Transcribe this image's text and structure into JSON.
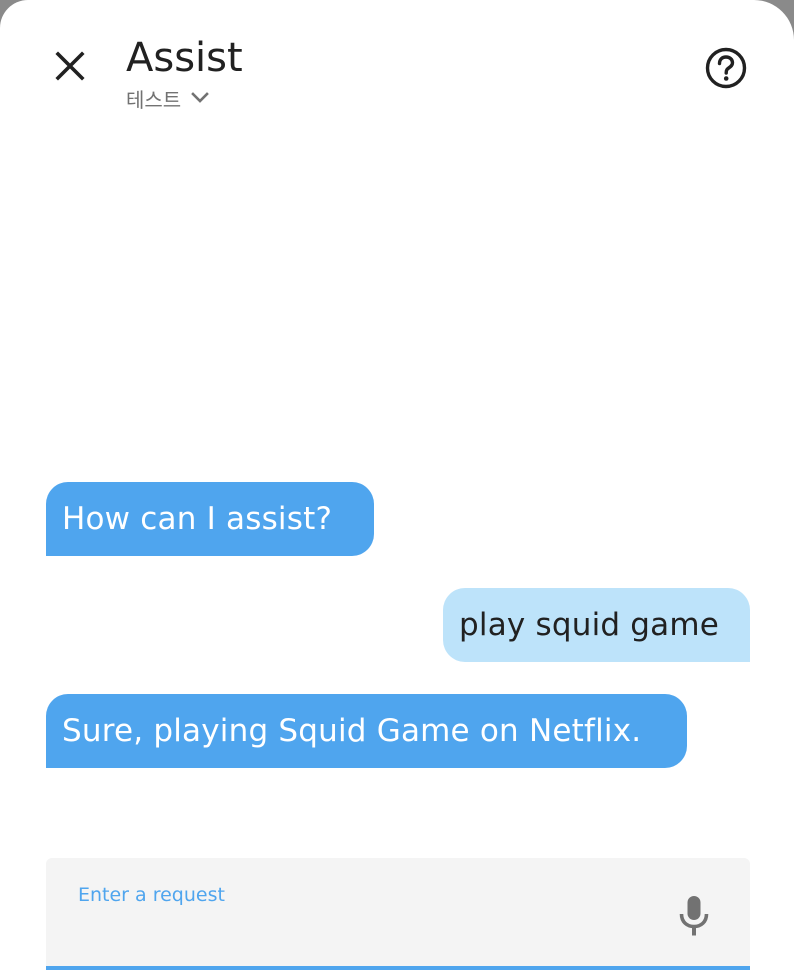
{
  "header": {
    "close_icon": "close-icon",
    "title": "Assist",
    "pipeline_name": "테스트",
    "pipeline_chevron_icon": "chevron-down-icon",
    "help_icon": "help-circle-icon"
  },
  "conversation": {
    "messages": [
      {
        "from": "assistant",
        "text": "How can I assist?"
      },
      {
        "from": "user",
        "text": "play squid game"
      },
      {
        "from": "assistant",
        "text": "Sure, playing Squid Game on Netflix."
      }
    ]
  },
  "input": {
    "label": "Enter a request",
    "value": "",
    "mic_icon": "microphone-icon"
  },
  "colors": {
    "assistant_bubble": "#4fa5ee",
    "user_bubble": "#bde3fa",
    "accent": "#4fa5ee",
    "input_background": "#f4f4f4"
  }
}
